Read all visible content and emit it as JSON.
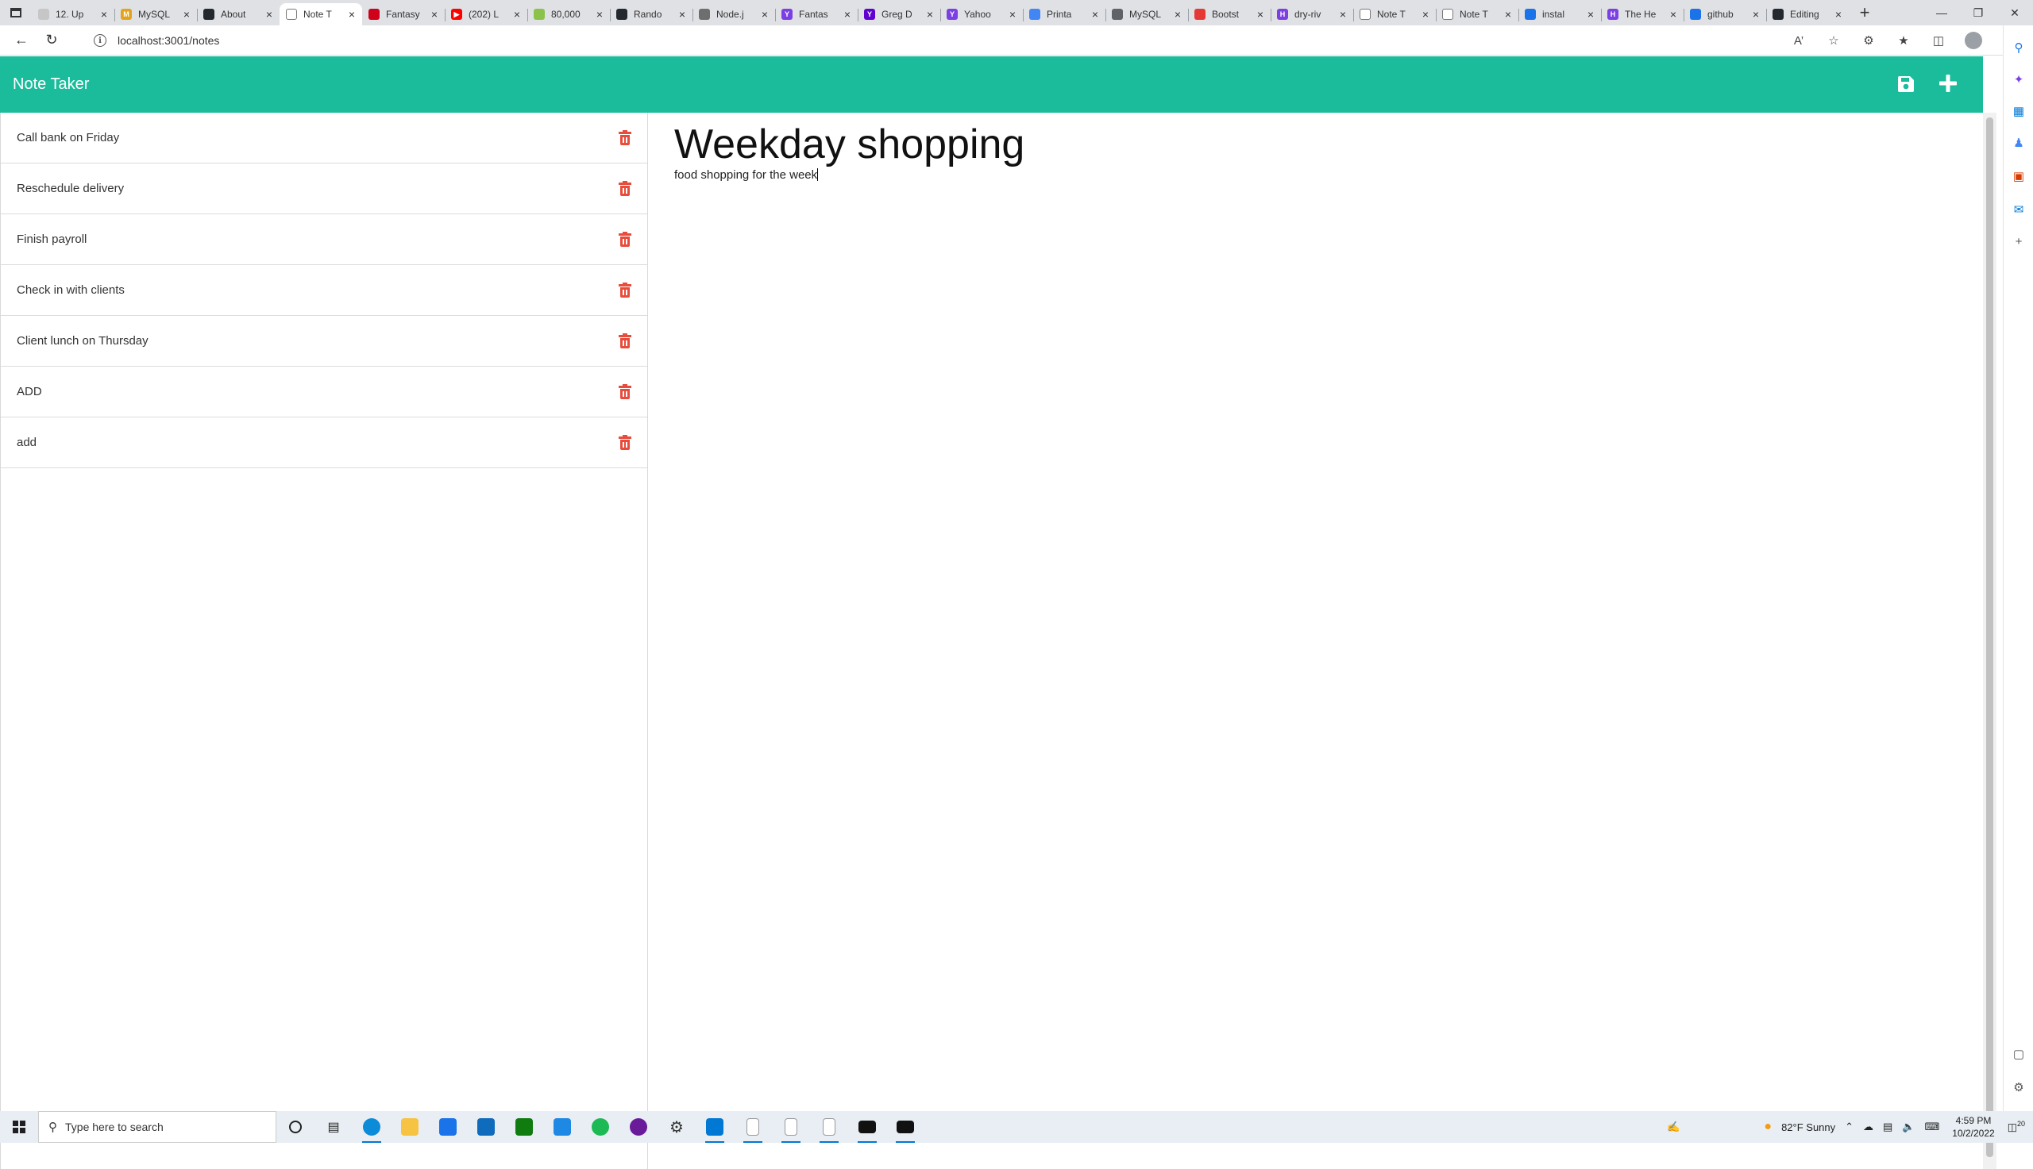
{
  "browser": {
    "tabs": [
      {
        "title": "12. Up",
        "color": "#c6c6c6",
        "glyph": "",
        "active": false
      },
      {
        "title": "MySQL",
        "color": "#e5a31a",
        "glyph": "M",
        "active": false
      },
      {
        "title": "About",
        "color": "#24292f",
        "glyph": "",
        "active": false
      },
      {
        "title": "Note T",
        "color": "#ffffff",
        "glyph": "",
        "active": true
      },
      {
        "title": "Fantasy",
        "color": "#d0021b",
        "glyph": "",
        "active": false
      },
      {
        "title": "(202) L",
        "color": "#ff0000",
        "glyph": "▶",
        "active": false
      },
      {
        "title": "80,000",
        "color": "#8bc34a",
        "glyph": "",
        "active": false
      },
      {
        "title": "Rando",
        "color": "#24292f",
        "glyph": "",
        "active": false
      },
      {
        "title": "Node.j",
        "color": "#6e6e6e",
        "glyph": "",
        "active": false
      },
      {
        "title": "Fantas",
        "color": "#7b3fe4",
        "glyph": "Y",
        "active": false
      },
      {
        "title": "Greg D",
        "color": "#6001d2",
        "glyph": "Y",
        "active": false
      },
      {
        "title": "Yahoo",
        "color": "#7b3fe4",
        "glyph": "Y",
        "active": false
      },
      {
        "title": "Printa",
        "color": "#4285f4",
        "glyph": "",
        "active": false
      },
      {
        "title": "MySQL",
        "color": "#5f6368",
        "glyph": "",
        "active": false
      },
      {
        "title": "Bootst",
        "color": "#e53935",
        "glyph": "",
        "active": false
      },
      {
        "title": "dry-riv",
        "color": "#7b3fe4",
        "glyph": "H",
        "active": false
      },
      {
        "title": "Note T",
        "color": "#ffffff",
        "glyph": "",
        "active": false
      },
      {
        "title": "Note T",
        "color": "#ffffff",
        "glyph": "",
        "active": false
      },
      {
        "title": "instal",
        "color": "#1a73e8",
        "glyph": "",
        "active": false
      },
      {
        "title": "The He",
        "color": "#7b3fe4",
        "glyph": "H",
        "active": false
      },
      {
        "title": "github",
        "color": "#1a73e8",
        "glyph": "",
        "active": false
      },
      {
        "title": "Editing",
        "color": "#24292f",
        "glyph": "",
        "active": false
      }
    ],
    "url": "localhost:3001/notes"
  },
  "app": {
    "title": "Note Taker",
    "accent": "#1abc9c",
    "delete_color": "#e74c3c",
    "notes": [
      {
        "title": "Call bank on Friday"
      },
      {
        "title": "Reschedule delivery"
      },
      {
        "title": "Finish payroll"
      },
      {
        "title": "Check in with clients"
      },
      {
        "title": "Client lunch on Thursday"
      },
      {
        "title": "ADD"
      },
      {
        "title": "add"
      }
    ],
    "active_note": {
      "title": "Weekday shopping",
      "text": "food shopping for the week"
    }
  },
  "taskbar": {
    "search_placeholder": "Type here to search",
    "weather": "82°F  Sunny",
    "time": "4:59 PM",
    "date": "10/2/2022",
    "notifications": "20"
  }
}
